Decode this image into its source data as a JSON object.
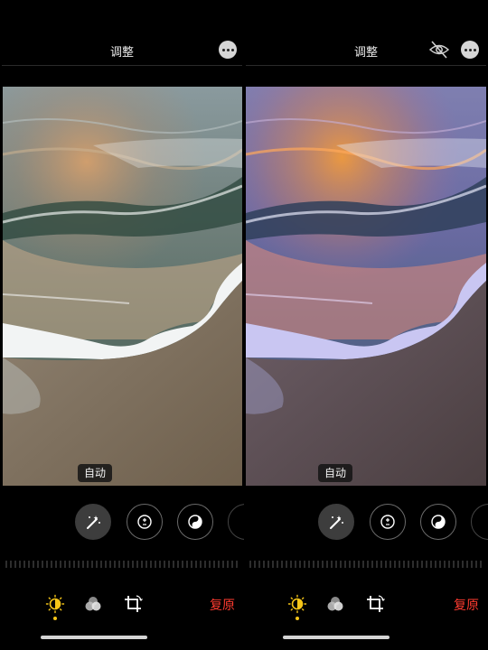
{
  "panes": [
    {
      "title": "调整",
      "auto_label": "自动",
      "revert_label": "复原",
      "icons": {
        "more": "more-icon",
        "magic": "magic-wand-icon",
        "exposure": "exposure-icon",
        "contrast": "contrast-icon",
        "adjust": "adjust-icon",
        "filters": "filters-icon",
        "crop": "crop-icon"
      },
      "filter_state": "original"
    },
    {
      "title": "调整",
      "auto_label": "自动",
      "revert_label": "复原",
      "icons": {
        "hide": "eye-slash-icon",
        "more": "more-icon",
        "magic": "magic-wand-icon",
        "exposure": "exposure-icon",
        "contrast": "contrast-icon",
        "adjust": "adjust-icon",
        "filters": "filters-icon",
        "crop": "crop-icon"
      },
      "filter_state": "auto-enhanced"
    }
  ],
  "colors": {
    "accent_yellow": "#f5c518",
    "revert_red": "#ff3b30",
    "background": "#000000"
  }
}
